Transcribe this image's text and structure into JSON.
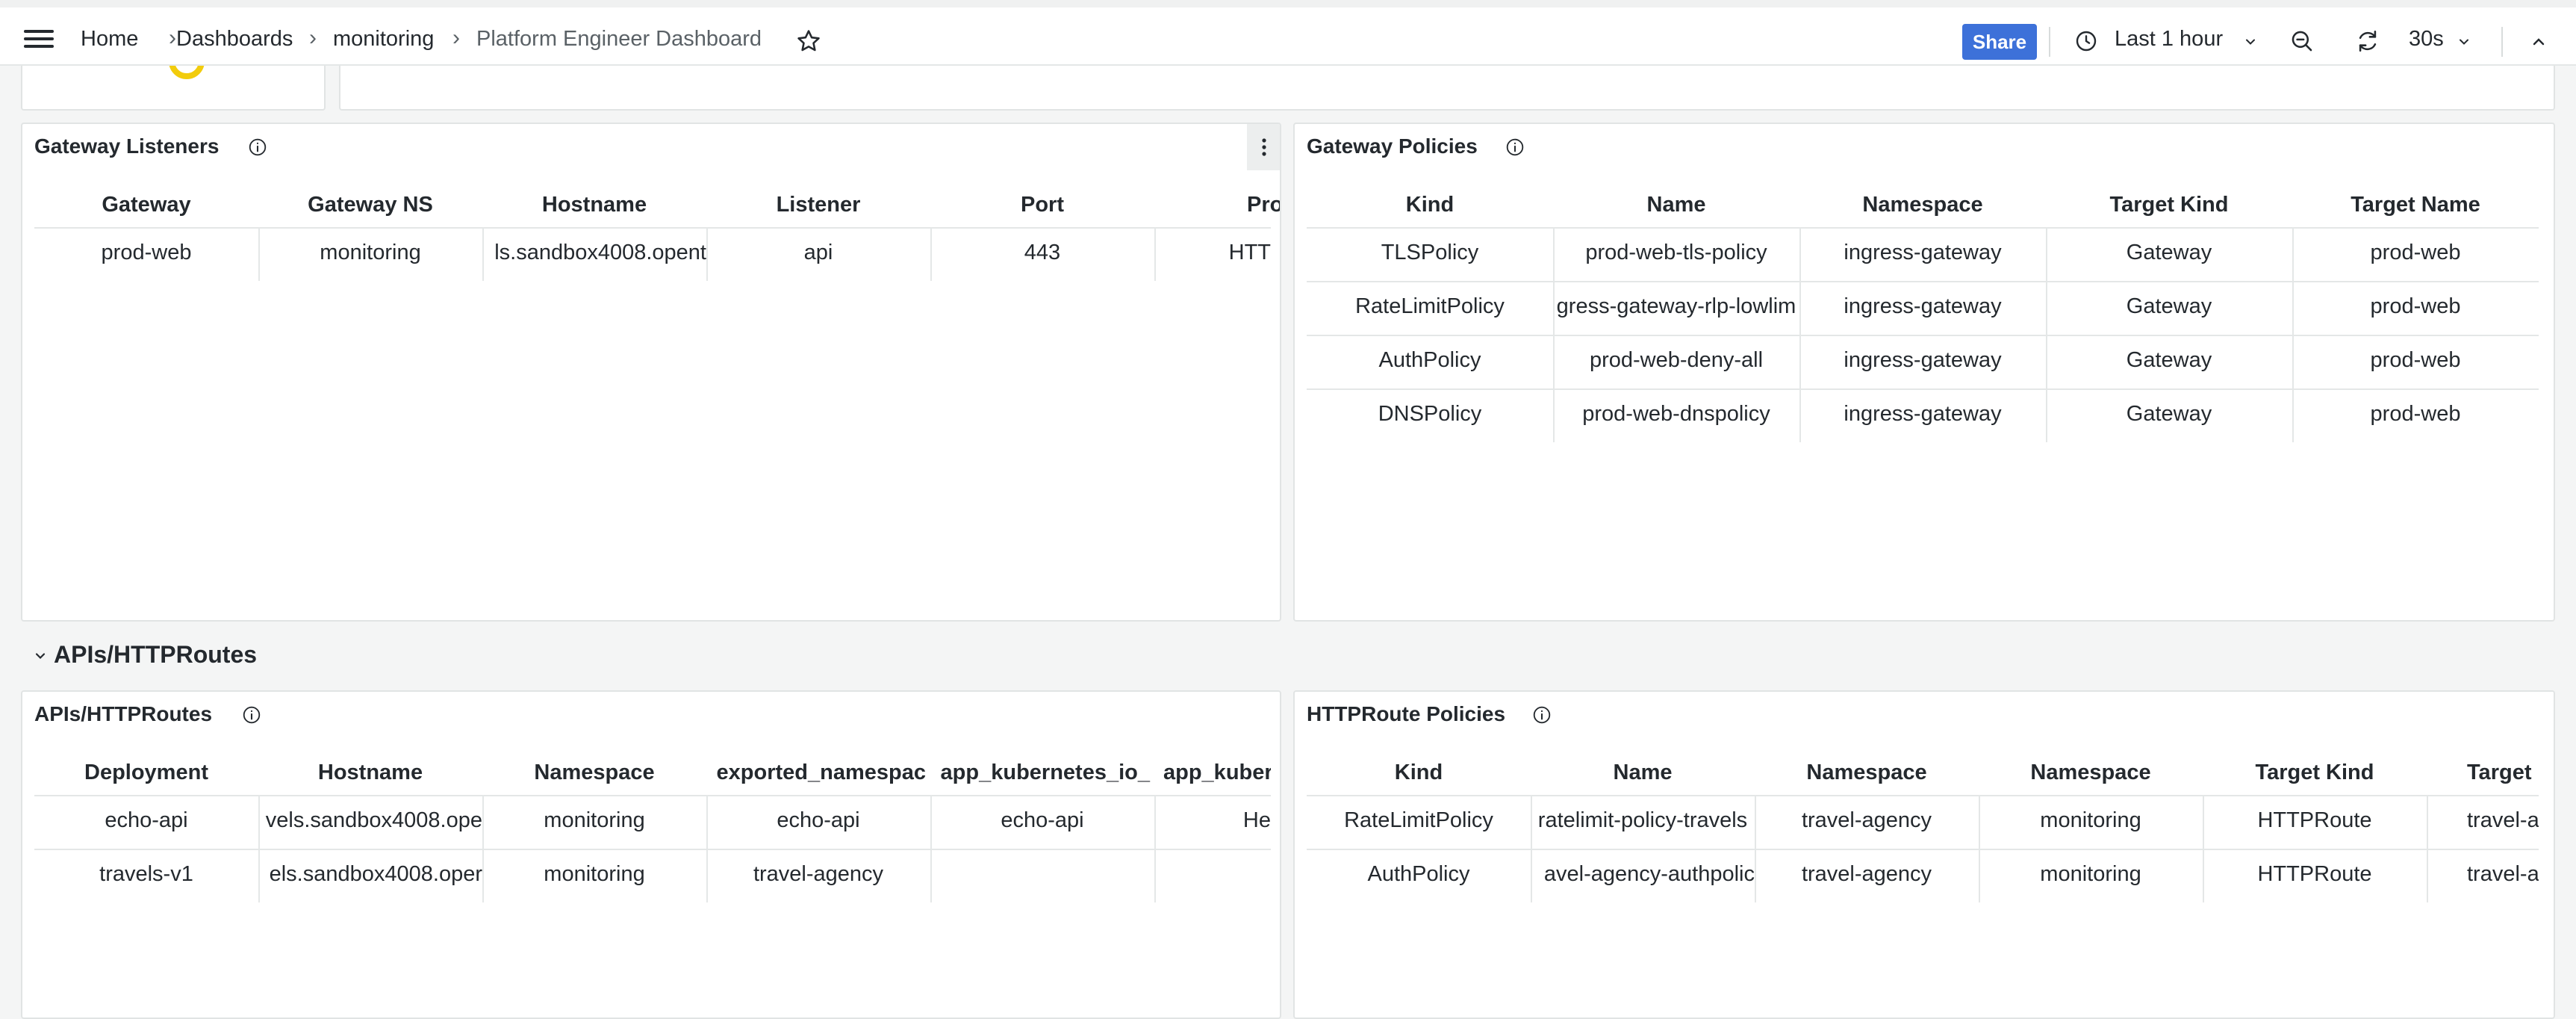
{
  "breadcrumb": {
    "items": [
      "Home",
      "Dashboards",
      "monitoring",
      "Platform Engineer Dashboard"
    ],
    "separator": "›"
  },
  "toolbar": {
    "share_label": "Share",
    "time_range": "Last 1 hour",
    "refresh_interval": "30s"
  },
  "section": {
    "title": "APIs/HTTPRoutes"
  },
  "gateway_listeners": {
    "title": "Gateway Listeners",
    "columns": [
      "Gateway",
      "Gateway NS",
      "Hostname",
      "Listener",
      "Port",
      "Proto"
    ],
    "rows": [
      [
        "prod-web",
        "monitoring",
        "ls.sandbox4008.opent",
        "api",
        "443",
        "HTT"
      ]
    ]
  },
  "gateway_policies": {
    "title": "Gateway Policies",
    "columns": [
      "Kind",
      "Name",
      "Namespace",
      "Target Kind",
      "Target Name"
    ],
    "rows": [
      [
        "TLSPolicy",
        "prod-web-tls-policy",
        "ingress-gateway",
        "Gateway",
        "prod-web"
      ],
      [
        "RateLimitPolicy",
        "gress-gateway-rlp-lowlim",
        "ingress-gateway",
        "Gateway",
        "prod-web"
      ],
      [
        "AuthPolicy",
        "prod-web-deny-all",
        "ingress-gateway",
        "Gateway",
        "prod-web"
      ],
      [
        "DNSPolicy",
        "prod-web-dnspolicy",
        "ingress-gateway",
        "Gateway",
        "prod-web"
      ]
    ]
  },
  "apis_httproutes": {
    "title": "APIs/HTTPRoutes",
    "columns": [
      "Deployment",
      "Hostname",
      "Namespace",
      "exported_namespac",
      "app_kubernetes_io_",
      "app_kuber"
    ],
    "rows": [
      [
        "echo-api",
        "vels.sandbox4008.ope",
        "monitoring",
        "echo-api",
        "echo-api",
        "He"
      ],
      [
        "travels-v1",
        "els.sandbox4008.oper",
        "monitoring",
        "travel-agency",
        "",
        ""
      ]
    ]
  },
  "httproute_policies": {
    "title": "HTTPRoute Policies",
    "columns": [
      "Kind",
      "Name",
      "Namespace",
      "Namespace",
      "Target Kind",
      "Target"
    ],
    "rows": [
      [
        "RateLimitPolicy",
        "ratelimit-policy-travels",
        "travel-agency",
        "monitoring",
        "HTTPRoute",
        "travel-a"
      ],
      [
        "AuthPolicy",
        "avel-agency-authpolic",
        "travel-agency",
        "monitoring",
        "HTTPRoute",
        "travel-a"
      ]
    ]
  },
  "colors": {
    "accent": "#3d71d9",
    "gauge": "#f2cc0c"
  }
}
